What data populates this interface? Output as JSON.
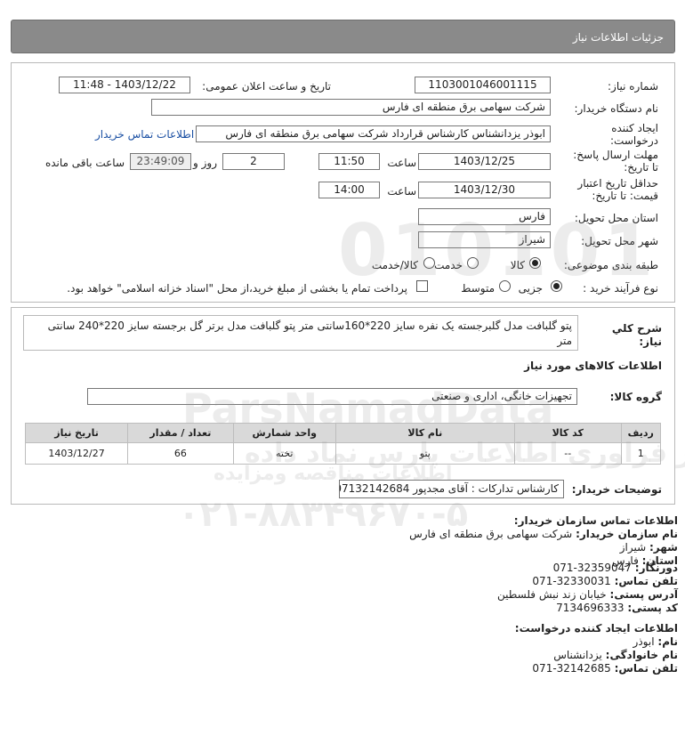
{
  "header": {
    "title": "جزئیات اطلاعات نیاز"
  },
  "form": {
    "need_number": {
      "label": "شماره نیاز:",
      "value": "1103001046001115"
    },
    "announce_datetime": {
      "label": "تاریخ و ساعت اعلان عمومی:",
      "value": "1403/12/22 - 11:48"
    },
    "buyer_org": {
      "label": "نام دستگاه خریدار:",
      "value": "شرکت سهامی برق منطقه ای فارس"
    },
    "requester": {
      "label_line1": "ایجاد کننده",
      "label_line2": "درخواست:",
      "value": "ابوذر  یزدانشناس کارشناس قرارداد شرکت سهامی برق منطقه ای فارس",
      "contact_link": "اطلاعات تماس خریدار"
    },
    "reply_deadline": {
      "label_line1": "مهلت ارسال پاسخ:",
      "label_line2": "تا تاریخ:",
      "date": "1403/12/25",
      "time_label": "ساعت",
      "time": "11:50",
      "days": "2",
      "days_label": "روز و",
      "remaining": "23:49:09",
      "remaining_label": "ساعت باقی مانده"
    },
    "price_validity": {
      "label_line1": "حداقل تاریخ اعتبار",
      "label_line2": "قیمت: تا تاریخ:",
      "date": "1403/12/30",
      "time_label": "ساعت",
      "time": "14:00"
    },
    "delivery_province": {
      "label": "استان محل تحویل:",
      "value": "فارس"
    },
    "delivery_city": {
      "label": "شهر محل تحویل:",
      "value": "شیراز"
    },
    "category": {
      "label": "طبقه بندی موضوعی:",
      "options": [
        "کالا",
        "خدمت",
        "کالا/خدمت"
      ],
      "selected": "کالا"
    },
    "process_type": {
      "label": "نوع فرآیند خرید :",
      "options": [
        "جزیی",
        "متوسط"
      ],
      "selected": "جزیی",
      "payment_note": "پرداخت تمام یا بخشی از مبلغ خرید،از محل \"اسناد خزانه اسلامی\" خواهد بود."
    }
  },
  "need_summary": {
    "label_line1": "شرح کلي",
    "label_line2": "نياز:",
    "value_line1": "پتو گلبافت مدل گلبرجسته یک نفره سایز 220*160سانتی متر پتو گلبافت مدل برتر گل برجسته سایز 220*240 سانتی",
    "value_line2": "متر"
  },
  "goods": {
    "section_title": "اطلاعات کالاهای مورد نیاز",
    "group_label": "گروه کالا:",
    "group_value": "تجهیزات خانگی، اداری و صنعتی",
    "table": {
      "headers": [
        "ردیف",
        "کد کالا",
        "نام کالا",
        "واحد شمارش",
        "تعداد / مقدار",
        "تاریخ نیاز"
      ],
      "rows": [
        [
          "1",
          "--",
          "پتو",
          "تخته",
          "66",
          "1403/12/27"
        ]
      ]
    },
    "buyer_notes_label": "توضیحات خریدار:",
    "buyer_notes_value": "کارشناس تدارکات : آقای مجدپور 07132142684"
  },
  "buyer_contact": {
    "title": "اطلاعات تماس سازمان خریدار:",
    "org_label": "نام سازمان خریدار:",
    "org_value": "شرکت سهامی برق منطقه ای فارس",
    "city_label": "شهر:",
    "city_value": "شیراز",
    "province_label": "استان:",
    "province_value": "فارس",
    "fax_label": "دورنگار:",
    "fax_value": "071-32359047",
    "phone_label": "تلفن تماس:",
    "phone_value": "071-32330031",
    "address_label": "آدرس پستی:",
    "address_value": "خیابان زند نبش فلسطین",
    "postal_label": "کد پستی:",
    "postal_value": "7134696333"
  },
  "creator_contact": {
    "title": "اطلاعات ایجاد کننده درخواست:",
    "name_label": "نام:",
    "name_value": "ابوذر",
    "family_label": "نام خانوادگی:",
    "family_value": "یزدانشناس",
    "phone_label": "تلفن تماس:",
    "phone_value": "071-32142685"
  },
  "watermark": {
    "line1": "010101",
    "line2": "ParsNamadData",
    "line3": "مرکز فراوری اطلاعات پارس نماد داده",
    "line4": "اطلاعات مناقصه ومزایده",
    "line5": "۰۲۱-۸۸۳۴۹۶۷۰-۵"
  }
}
